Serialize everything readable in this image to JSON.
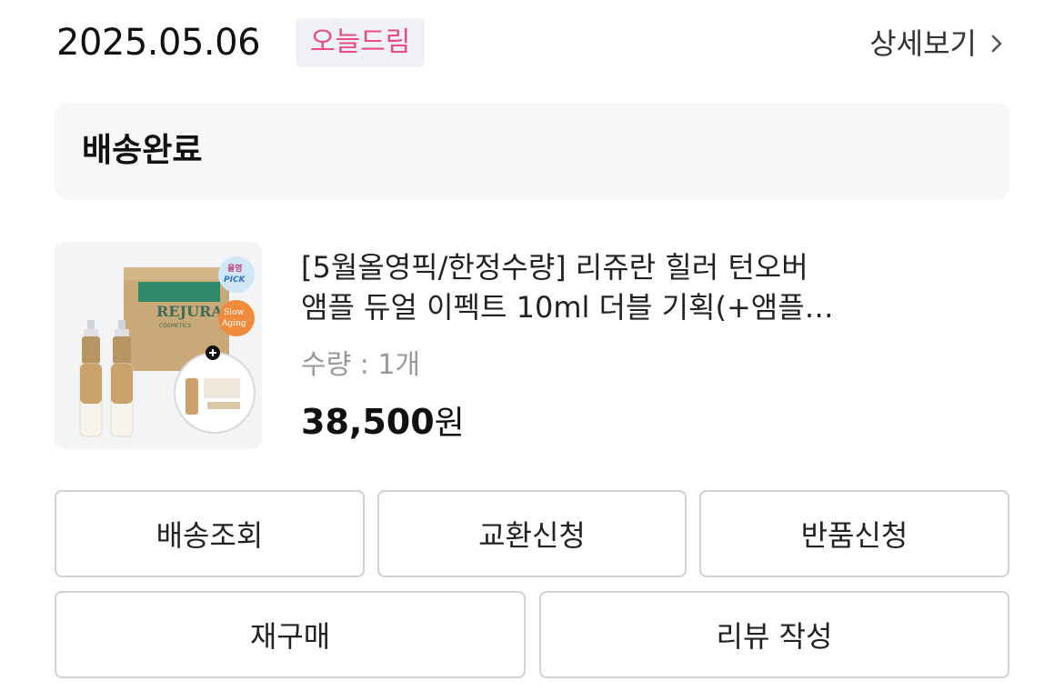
{
  "order": {
    "date": "2025.05.06",
    "badge": "오늘드림",
    "detail_link": "상세보기"
  },
  "status": {
    "label": "배송완료"
  },
  "product": {
    "name_line1": "[5월올영픽/한정수량] 리쥬란 힐러 턴오버",
    "name_line2": "앰플 듀얼 이펙트 10ml 더블 기획(+앰플…",
    "quantity": "수량 : 1개",
    "price": "38,500",
    "price_unit": "원",
    "image": {
      "brand_text": "REJURAN",
      "brand_sub": "COSMETICS",
      "badge_pick_top": "올영",
      "badge_pick_bottom": "PICK",
      "badge_slow_top": "Slow",
      "badge_slow_bottom": "Aging"
    }
  },
  "actions": {
    "track": "배송조회",
    "exchange": "교환신청",
    "return": "반품신청",
    "reorder": "재구매",
    "review": "리뷰 작성"
  },
  "colors": {
    "badge_text": "#ea4a8c",
    "badge_bg": "#f0f1f4",
    "status_bg": "#f6f7f9",
    "button_border": "#cfd1d6"
  }
}
